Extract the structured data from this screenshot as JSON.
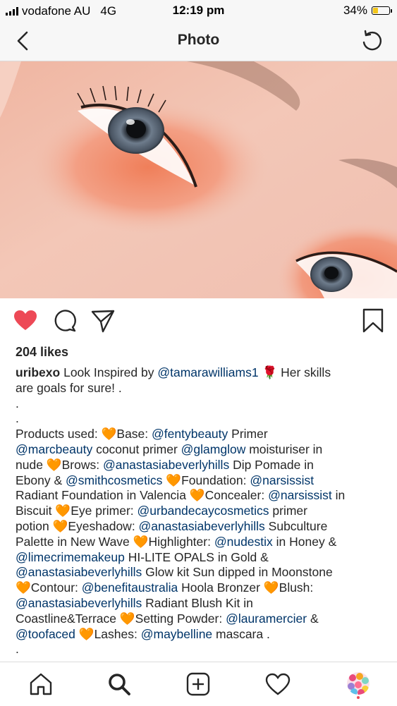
{
  "status_bar": {
    "carrier": "vodafone AU",
    "network": "4G",
    "time": "12:19 pm",
    "battery": "34%",
    "battery_level": 0.34,
    "battery_color": "#f3c61a"
  },
  "header": {
    "title": "Photo",
    "back_icon": "chevron-left-icon",
    "refresh_icon": "refresh-icon"
  },
  "post": {
    "image": "close-up-eye-makeup-photo",
    "liked": true,
    "like_color": "#ed4956",
    "likes": "204 likes",
    "caption_lines": [
      [
        {
          "t": "uribexo",
          "k": "u"
        },
        {
          "t": " Look Inspired by "
        },
        {
          "t": "@tamarawilliams1",
          "k": "m"
        },
        {
          "t": " 🌹  Her skills"
        }
      ],
      [
        {
          "t": "are goals for sure! ."
        }
      ],
      [
        {
          "t": "."
        }
      ],
      [
        {
          "t": "."
        }
      ],
      [
        {
          "t": "Products used: "
        },
        {
          "t": "🧡",
          "k": "e"
        },
        {
          "t": "Base: "
        },
        {
          "t": "@fentybeauty",
          "k": "m"
        },
        {
          "t": " Primer"
        }
      ],
      [
        {
          "t": "@marcbeauty",
          "k": "m"
        },
        {
          "t": " coconut primer "
        },
        {
          "t": "@glamglow",
          "k": "m"
        },
        {
          "t": " moisturiser in"
        }
      ],
      [
        {
          "t": "nude "
        },
        {
          "t": "🧡",
          "k": "e"
        },
        {
          "t": "Brows: "
        },
        {
          "t": "@anastasiabeverlyhills",
          "k": "m"
        },
        {
          "t": " Dip Pomade in"
        }
      ],
      [
        {
          "t": "Ebony & "
        },
        {
          "t": "@smithcosmetics",
          "k": "m"
        },
        {
          "t": " "
        },
        {
          "t": "🧡",
          "k": "e"
        },
        {
          "t": "Foundation: "
        },
        {
          "t": "@narsissist",
          "k": "m"
        }
      ],
      [
        {
          "t": "Radiant Foundation in Valencia "
        },
        {
          "t": "🧡",
          "k": "e"
        },
        {
          "t": "Concealer: "
        },
        {
          "t": "@narsissist",
          "k": "m"
        },
        {
          "t": " in"
        }
      ],
      [
        {
          "t": "Biscuit "
        },
        {
          "t": "🧡",
          "k": "e"
        },
        {
          "t": "Eye primer: "
        },
        {
          "t": "@urbandecaycosmetics",
          "k": "m"
        },
        {
          "t": " primer"
        }
      ],
      [
        {
          "t": "potion "
        },
        {
          "t": "🧡",
          "k": "e"
        },
        {
          "t": "Eyeshadow: "
        },
        {
          "t": "@anastasiabeverlyhills",
          "k": "m"
        },
        {
          "t": " Subculture"
        }
      ],
      [
        {
          "t": "Palette in New Wave "
        },
        {
          "t": "🧡",
          "k": "e"
        },
        {
          "t": "Highlighter: "
        },
        {
          "t": "@nudestix",
          "k": "m"
        },
        {
          "t": " in Honey &"
        }
      ],
      [
        {
          "t": "@limecrimemakeup",
          "k": "m"
        },
        {
          "t": " HI-LITE OPALS in Gold &"
        }
      ],
      [
        {
          "t": "@anastasiabeverlyhills",
          "k": "m"
        },
        {
          "t": " Glow kit Sun dipped in Moonstone"
        }
      ],
      [
        {
          "t": "🧡",
          "k": "e"
        },
        {
          "t": "Contour: "
        },
        {
          "t": "@benefitaustralia",
          "k": "m"
        },
        {
          "t": " Hoola Bronzer "
        },
        {
          "t": "🧡",
          "k": "e"
        },
        {
          "t": "Blush:"
        }
      ],
      [
        {
          "t": "@anastasiabeverlyhills",
          "k": "m"
        },
        {
          "t": " Radiant Blush Kit in"
        }
      ],
      [
        {
          "t": "Coastline&Terrace "
        },
        {
          "t": "🧡",
          "k": "e"
        },
        {
          "t": "Setting Powder: "
        },
        {
          "t": "@lauramercier",
          "k": "m"
        },
        {
          "t": " &"
        }
      ],
      [
        {
          "t": "@toofaced",
          "k": "m"
        },
        {
          "t": " "
        },
        {
          "t": "🧡",
          "k": "e"
        },
        {
          "t": "Lashes: "
        },
        {
          "t": "@maybelline",
          "k": "m"
        },
        {
          "t": " mascara ."
        }
      ],
      [
        {
          "t": "."
        }
      ]
    ]
  },
  "tab_bar": {
    "tabs": [
      "home-icon",
      "search-icon",
      "new-post-icon",
      "activity-heart-icon",
      "profile-avatar"
    ],
    "active": "search-icon"
  }
}
